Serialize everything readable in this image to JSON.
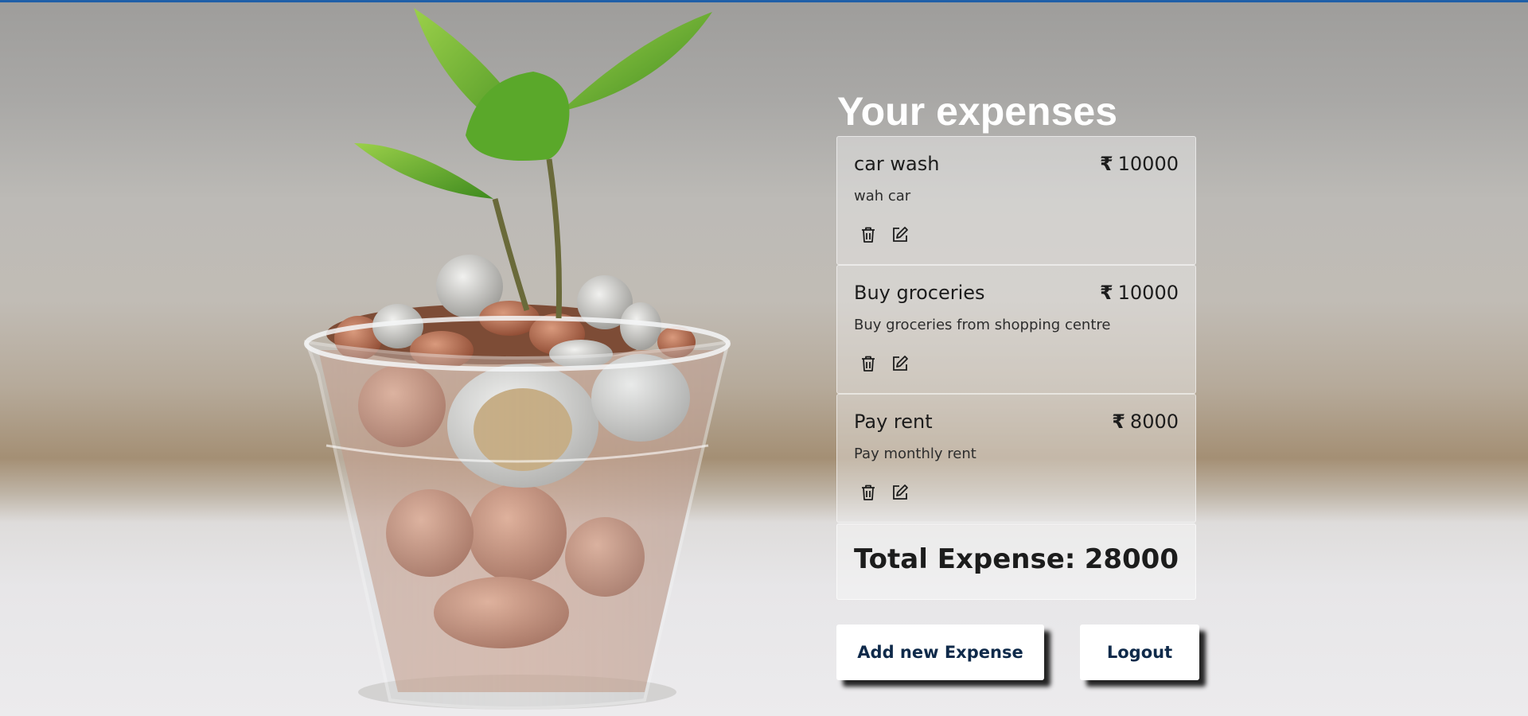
{
  "page": {
    "title": "Your expenses"
  },
  "expenses": [
    {
      "name": "car wash",
      "currency": "₹",
      "amount": "10000",
      "description": "wah car"
    },
    {
      "name": "Buy groceries",
      "currency": "₹",
      "amount": "10000",
      "description": "Buy groceries from shopping centre"
    },
    {
      "name": "Pay rent",
      "currency": "₹",
      "amount": "8000",
      "description": "Pay monthly rent"
    }
  ],
  "icons": {
    "delete": "trash-icon",
    "edit": "edit-icon"
  },
  "total": {
    "label": "Total Expense:",
    "value": "28000"
  },
  "actions": {
    "add_label": "Add new Expense",
    "logout_label": "Logout"
  },
  "colors": {
    "top_line": "#1f5fa8",
    "button_text": "#0f2a4a",
    "title": "#ffffff"
  }
}
